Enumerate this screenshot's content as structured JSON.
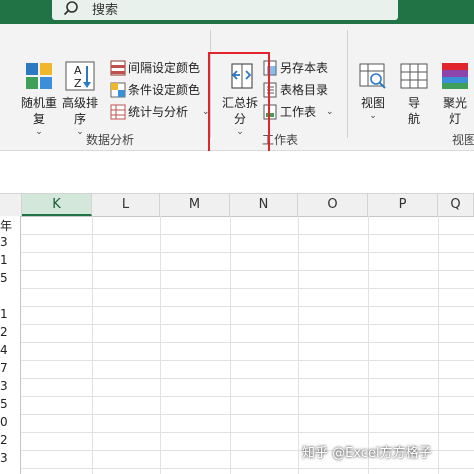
{
  "search": {
    "label": "搜索"
  },
  "ribbon": {
    "data_analysis": {
      "random_repeat": {
        "line1": "随机重",
        "line2": "复"
      },
      "advanced_sort": {
        "line1": "高级排",
        "line2": "序"
      },
      "interval_color": "间隔设定颜色",
      "condition_color": "条件设定颜色",
      "stats_analysis": "统计与分析",
      "group_label": "数据分析"
    },
    "worksheet": {
      "summary_split": {
        "line1": "汇总拆",
        "line2": "分"
      },
      "save_sheet": "另存本表",
      "sheet_toc": "表格目录",
      "worksheet_menu": "工作表",
      "group_label": "工作表"
    },
    "view": {
      "view": "视图",
      "navigation": {
        "line1": "导",
        "line2": "航"
      },
      "spotlight": {
        "line1": "聚光",
        "line2": "灯"
      },
      "group_label_partial": "视图"
    }
  },
  "sheet": {
    "columns": [
      "K",
      "L",
      "M",
      "N",
      "O",
      "P",
      "Q"
    ],
    "selected_column": "K",
    "row_fragments": [
      "年",
      "3",
      "1",
      "5",
      "",
      "1",
      "2",
      "4",
      "7",
      "3",
      "5",
      "0",
      "2",
      "3"
    ]
  },
  "watermark": "知乎 @Excel方方格子",
  "colors": {
    "accent": "#217346",
    "highlight_box": "#e0262c"
  }
}
